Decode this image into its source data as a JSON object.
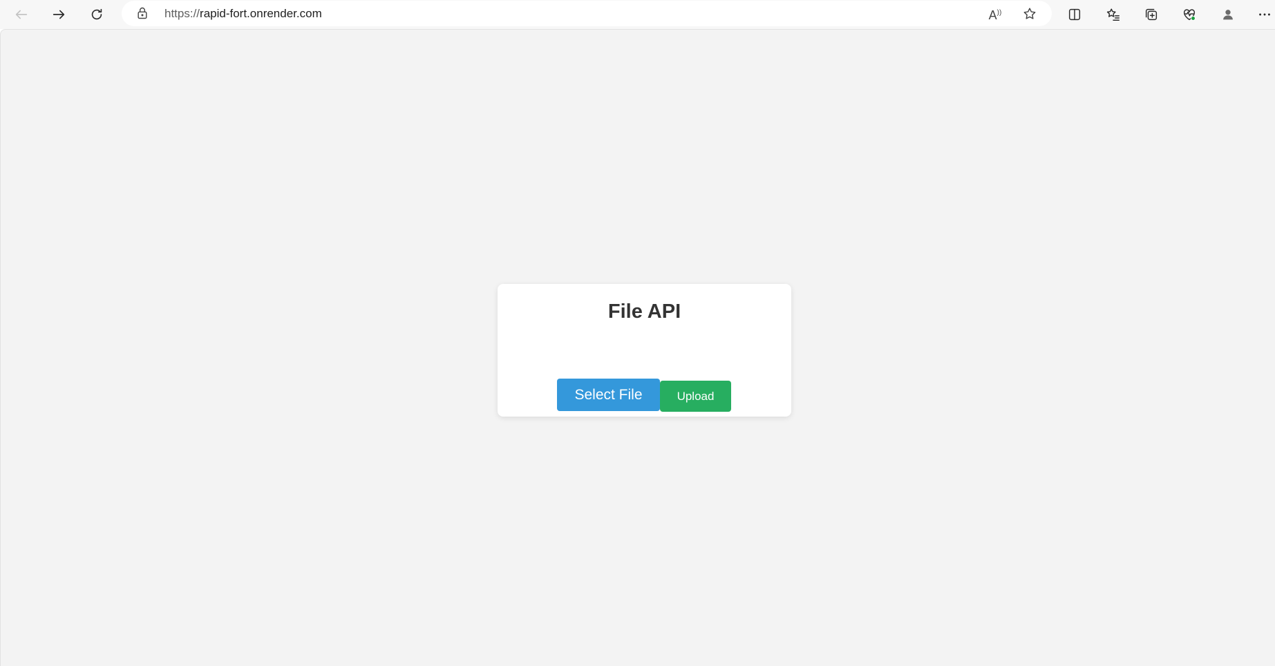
{
  "browser": {
    "url_scheme": "https://",
    "url_host": "rapid-fort.onrender.com",
    "read_aloud_label": "A",
    "read_aloud_sup": "))",
    "icons": {
      "back": "back-arrow-icon",
      "forward": "forward-arrow-icon",
      "refresh": "refresh-icon",
      "lock": "lock-icon",
      "favorite": "star-icon",
      "split_screen": "split-screen-icon",
      "favorites": "favorites-list-icon",
      "collections": "collections-icon",
      "browser_essentials": "heartbeat-icon",
      "profile": "profile-icon",
      "more": "more-icon"
    }
  },
  "page": {
    "title": "File API",
    "select_file_label": "Select File",
    "upload_label": "Upload"
  },
  "colors": {
    "page_background": "#f3f3f3",
    "select_button": "#3498db",
    "upload_button": "#27ae60",
    "title_text": "#333333"
  }
}
